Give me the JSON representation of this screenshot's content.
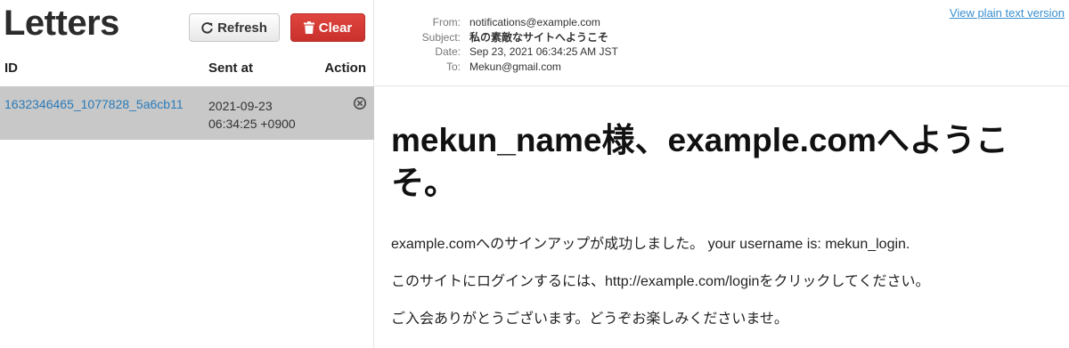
{
  "sidebar": {
    "title": "Letters",
    "refresh_label": "Refresh",
    "clear_label": "Clear",
    "columns": {
      "id": "ID",
      "sent_at": "Sent at",
      "action": "Action"
    },
    "letters": [
      {
        "id": "1632346465_1077828_5a6cb11",
        "sent_date": "2021-09-23",
        "sent_time": "06:34:25 +0900"
      }
    ]
  },
  "message": {
    "header_labels": {
      "from": "From:",
      "subject": "Subject:",
      "date": "Date:",
      "to": "To:"
    },
    "from": "notifications@example.com",
    "subject": "私の素敵なサイトへようこそ",
    "date": "Sep 23, 2021 06:34:25 AM JST",
    "to": "Mekun@gmail.com",
    "plain_text_link": "View plain text version",
    "heading": "mekun_name様、example.comへようこそ。",
    "paragraphs": [
      "example.comへのサインアップが成功しました。 your username is: mekun_login.",
      "このサイトにログインするには、http://example.com/loginをクリックしてください。",
      "ご入会ありがとうございます。どうぞお楽しみくださいませ。"
    ]
  },
  "colors": {
    "link": "#2a7ab8",
    "danger": "#c9302c",
    "selected_row": "#c8c8c8"
  }
}
